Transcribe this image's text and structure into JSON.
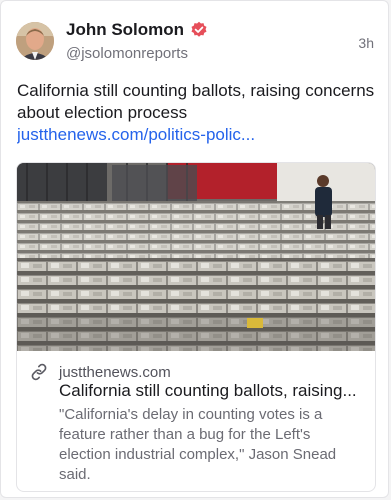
{
  "post": {
    "author_name": "John Solomon",
    "author_handle": "@jsolomonreports",
    "timestamp": "3h",
    "text": "California still counting ballots, raising concerns about election process",
    "link_text": "justthenews.com/politics-polic...",
    "verified_icon": "verified-badge-icon",
    "colors": {
      "verified": "#e64f5a",
      "link": "#2563eb"
    }
  },
  "card": {
    "image_icon": "warehouse-ballots-photo",
    "domain": "justthenews.com",
    "title": "California still counting ballots, raising...",
    "description": "\"California's delay in counting votes is a feature rather than a bug for the Left's election industrial complex,\" Jason Snead said."
  }
}
